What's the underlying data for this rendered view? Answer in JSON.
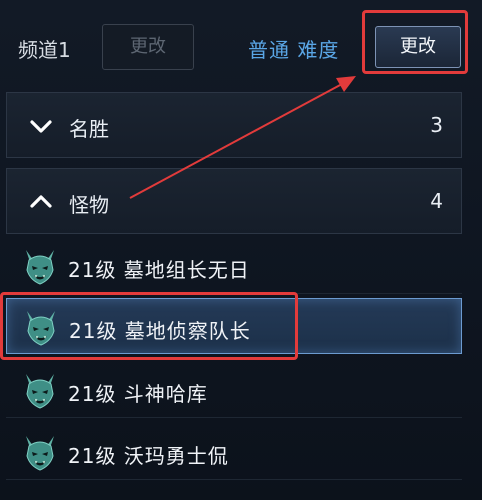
{
  "header": {
    "channel_label": "频道1",
    "channel_change_label": "更改",
    "difficulty_label": "普通 难度",
    "change_label": "更改"
  },
  "sections": [
    {
      "label": "名胜",
      "count": "3",
      "expanded": false,
      "icon": "chevron-down-icon"
    },
    {
      "label": "怪物",
      "count": "4",
      "expanded": true,
      "icon": "chevron-up-icon"
    }
  ],
  "monsters": [
    {
      "label": "21级 墓地组长无日",
      "selected": false,
      "icon": "demon-head-icon"
    },
    {
      "label": "21级 墓地侦察队长",
      "selected": true,
      "icon": "demon-head-icon"
    },
    {
      "label": "21级 斗神哈库",
      "selected": false,
      "icon": "demon-head-icon"
    },
    {
      "label": "21级 沃玛勇士侃",
      "selected": false,
      "icon": "demon-head-icon"
    }
  ],
  "colors": {
    "accent_blue": "#5aa6e6",
    "highlight_red": "#e23b3b",
    "selected_bg": "#243a57"
  }
}
